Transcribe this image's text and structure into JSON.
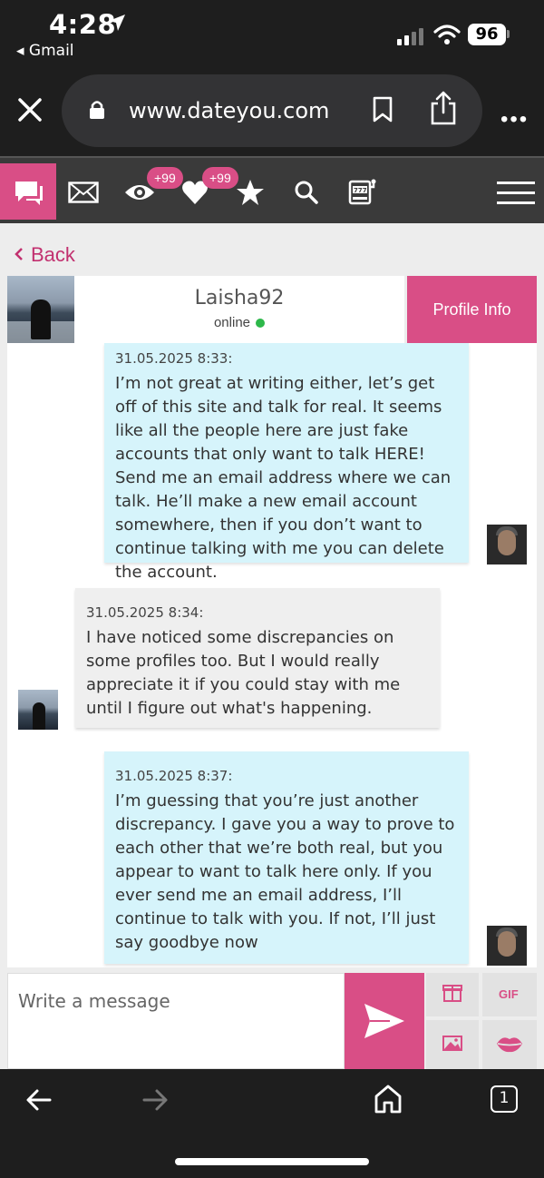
{
  "status_bar": {
    "time": "4:28",
    "back_app": "◂ Gmail",
    "battery": "96"
  },
  "browser": {
    "url": "www.dateyou.com"
  },
  "site_nav": {
    "views_badge": "+99",
    "likes_badge": "+99"
  },
  "page": {
    "back_label": "Back"
  },
  "profile": {
    "name": "Laisha92",
    "status": "online",
    "info_button": "Profile Info"
  },
  "messages": [
    {
      "sender": "me",
      "timestamp": "31.05.2025 8:33:",
      "text": "I’m not great at writing either, let’s get off of this site and talk for real. It seems like all the people here are just fake accounts that only want to talk HERE! Send me an email address where we can talk. He’ll make a new email account somewhere, then if you don’t want to continue talking with me you can delete the account."
    },
    {
      "sender": "them",
      "timestamp": "31.05.2025 8:34:",
      "text": "I have noticed some discrepancies on some profiles too. But I would really appreciate it if you could stay with me until I figure out what's happening."
    },
    {
      "sender": "me",
      "timestamp": "31.05.2025 8:37:",
      "text": "I’m guessing that you’re just another discrepancy. I gave you a way to prove to each other that we’re both real, but you appear to want to talk here only. If you ever send me an email address, I’ll continue to talk with you. If not, I’ll just say goodbye now"
    }
  ],
  "composer": {
    "placeholder": "Write a message",
    "gif_label": "GIF"
  },
  "bottom_bar": {
    "tab_count": "1"
  },
  "colors": {
    "accent": "#d94e86",
    "my_bubble": "#d6f4fb",
    "their_bubble": "#efefef",
    "online": "#2db84a"
  }
}
